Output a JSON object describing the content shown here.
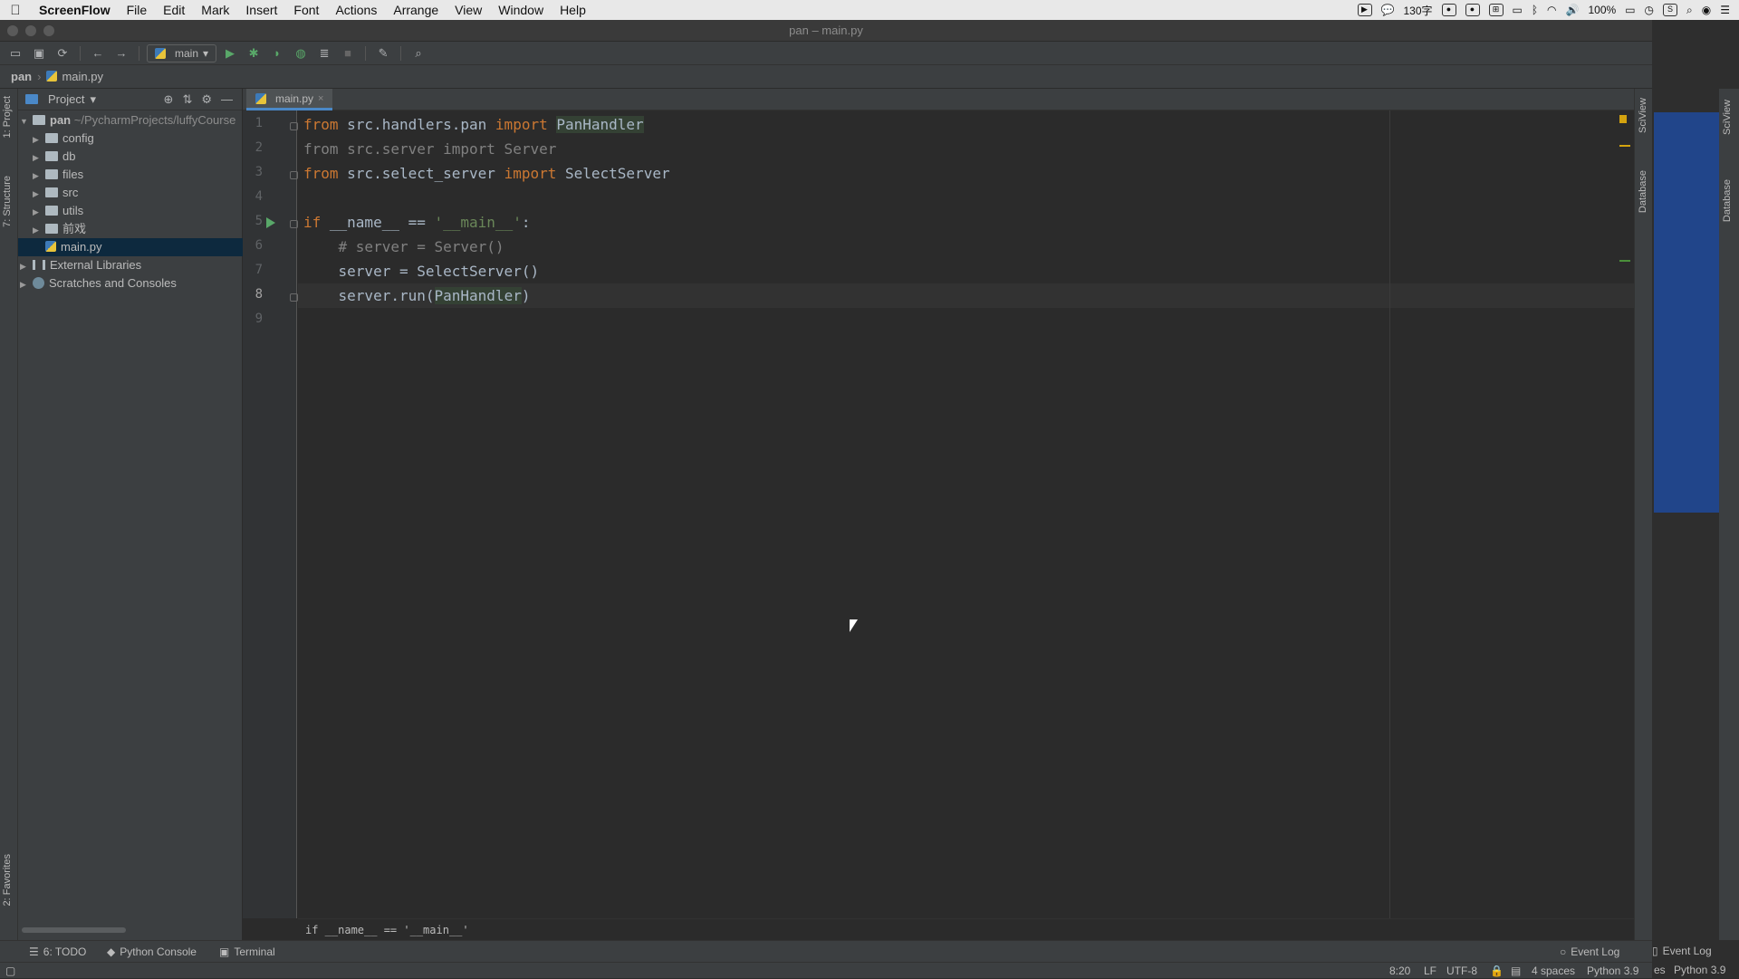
{
  "menubar": {
    "app_name": "ScreenFlow",
    "items": [
      "File",
      "Edit",
      "Mark",
      "Insert",
      "Font",
      "Actions",
      "Arrange",
      "View",
      "Window",
      "Help"
    ],
    "input_method": "130字",
    "battery": "100%"
  },
  "window": {
    "title": "pan – main.py"
  },
  "toolbar": {
    "run_config": "main"
  },
  "breadcrumb": {
    "project": "pan",
    "file": "main.py"
  },
  "side_tabs": {
    "project": "1: Project",
    "structure": "7: Structure",
    "favorites": "2: Favorites",
    "sciview": "SciView",
    "database": "Database"
  },
  "project_panel": {
    "title": "Project",
    "root": {
      "name": "pan",
      "path": "~/PycharmProjects/luffyCourse"
    },
    "folders": [
      "config",
      "db",
      "files",
      "src",
      "utils",
      "前戏"
    ],
    "file": "main.py",
    "external": "External Libraries",
    "scratches": "Scratches and Consoles"
  },
  "editor": {
    "tab": "main.py",
    "line_numbers": [
      "1",
      "2",
      "3",
      "4",
      "5",
      "6",
      "7",
      "8",
      "9"
    ],
    "code": {
      "l1_kw": "from",
      "l1_mod": " src.handlers.pan ",
      "l1_import": "import",
      "l1_name": "PanHandler",
      "l2": "from src.server import Server",
      "l3_kw": "from",
      "l3_mod": " src.select_server ",
      "l3_import": "import",
      "l3_name": " SelectServer",
      "l5_kw": "if",
      "l5_mid": " __name__ == ",
      "l5_str": "'__main__'",
      "l5_end": ":",
      "l6": "    # server = Server()",
      "l7": "    server = SelectServer()",
      "l8_pre": "    server.run(",
      "l8_arg": "PanHandler",
      "l8_end": ")"
    },
    "breadcrumb_bottom": "if __name__ == '__main__'"
  },
  "bottom_tools": {
    "todo": "6: TODO",
    "python_console": "Python Console",
    "terminal": "Terminal",
    "event_log": "Event Log",
    "event_log_2": "Event Log"
  },
  "status": {
    "position": "8:20",
    "line_sep": "LF",
    "encoding": "UTF-8",
    "indent": "4 spaces",
    "interpreter": "Python 3.9",
    "interpreter_2": "Python 3.9",
    "fragment": "es"
  },
  "colors": {
    "keyword": "#cc7832",
    "string": "#6a8759",
    "comment": "#808080",
    "text": "#a9b7c6",
    "selection": "#0d293e",
    "run_green": "#59a869"
  }
}
